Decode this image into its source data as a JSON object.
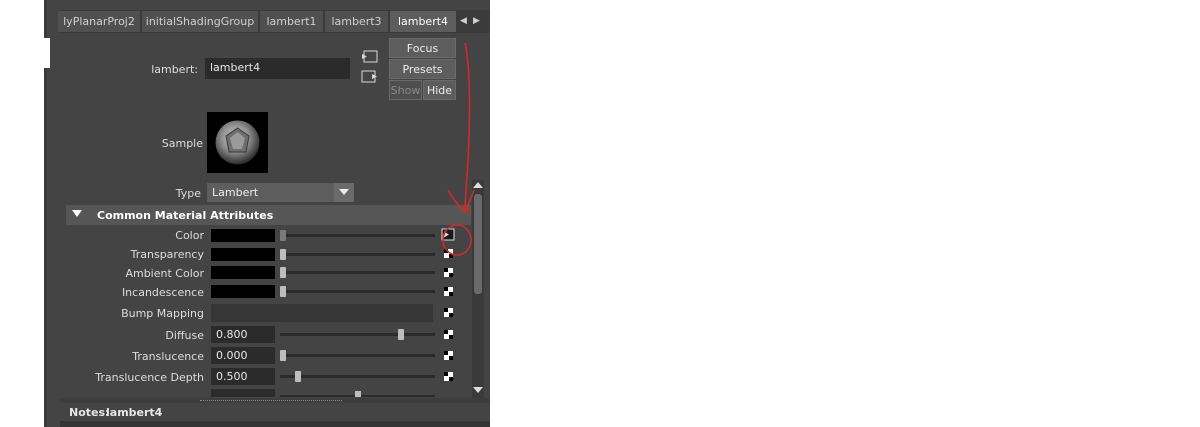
{
  "tabs": [
    {
      "label": "lyPlanarProj2",
      "active": false
    },
    {
      "label": "initialShadingGroup",
      "active": false
    },
    {
      "label": "lambert1",
      "active": false
    },
    {
      "label": "lambert3",
      "active": false
    },
    {
      "label": "lambert4",
      "active": true
    }
  ],
  "header": {
    "node_type_label": "lambert:",
    "node_name": "lambert4",
    "focus_label": "Focus",
    "presets_label": "Presets",
    "show_label": "Show",
    "hide_label": "Hide"
  },
  "sample": {
    "label": "Sample"
  },
  "type_row": {
    "label": "Type",
    "value": "Lambert"
  },
  "section": {
    "title": "Common Material Attributes"
  },
  "attributes": {
    "color": {
      "label": "Color"
    },
    "transparency": {
      "label": "Transparency"
    },
    "ambient": {
      "label": "Ambient Color"
    },
    "incandescence": {
      "label": "Incandescence"
    },
    "bump": {
      "label": "Bump Mapping"
    },
    "diffuse": {
      "label": "Diffuse",
      "value": "0.800",
      "level": 0.8
    },
    "translucence": {
      "label": "Translucence",
      "value": "0.000",
      "level": 0.0
    },
    "translucence_depth": {
      "label": "Translucence Depth",
      "value": "0.500",
      "level": 0.1
    }
  },
  "notes": {
    "label": "Notes:",
    "value": "lambert4"
  },
  "colors": {
    "annotation": "#d22a2a",
    "panel": "#444444"
  }
}
